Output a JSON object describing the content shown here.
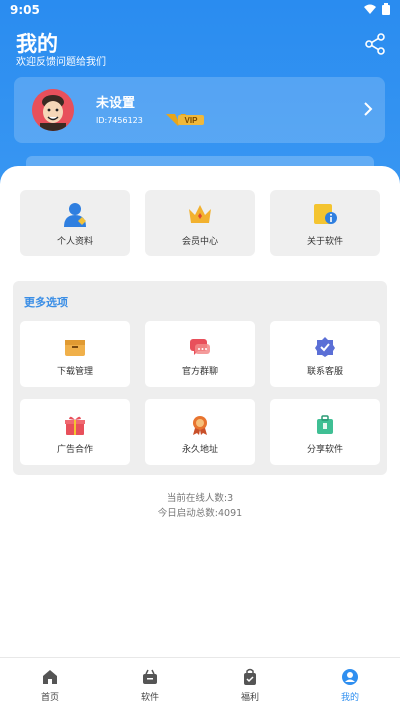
{
  "status_bar": {
    "time": "9:05"
  },
  "header": {
    "title": "我的",
    "subtitle": "欢迎反馈问题给我们"
  },
  "user": {
    "name": "未设置",
    "id": "ID:7456123",
    "badge": "VIP"
  },
  "top_tiles": [
    {
      "label": "个人资料",
      "icon": "person-icon"
    },
    {
      "label": "会员中心",
      "icon": "crown-icon"
    },
    {
      "label": "关于软件",
      "icon": "info-folder-icon"
    }
  ],
  "more_section": {
    "title": "更多选项",
    "items": [
      {
        "label": "下载管理",
        "icon": "box-icon"
      },
      {
        "label": "官方群聊",
        "icon": "chat-icon"
      },
      {
        "label": "联系客服",
        "icon": "service-badge-icon"
      },
      {
        "label": "广告合作",
        "icon": "gift-icon"
      },
      {
        "label": "永久地址",
        "icon": "medal-icon"
      },
      {
        "label": "分享软件",
        "icon": "suitcase-icon"
      }
    ]
  },
  "stats": {
    "online": "当前在线人数:3",
    "launches": "今日启动总数:4091"
  },
  "tabbar": {
    "tabs": [
      {
        "label": "首页",
        "icon": "home-icon"
      },
      {
        "label": "软件",
        "icon": "software-icon"
      },
      {
        "label": "福利",
        "icon": "welfare-icon"
      },
      {
        "label": "我的",
        "icon": "profile-icon"
      }
    ],
    "active_index": 3
  },
  "colors": {
    "accent": "#2f8ff0",
    "panel": "#eeeeee",
    "vip_gold": "#e8a51a"
  }
}
